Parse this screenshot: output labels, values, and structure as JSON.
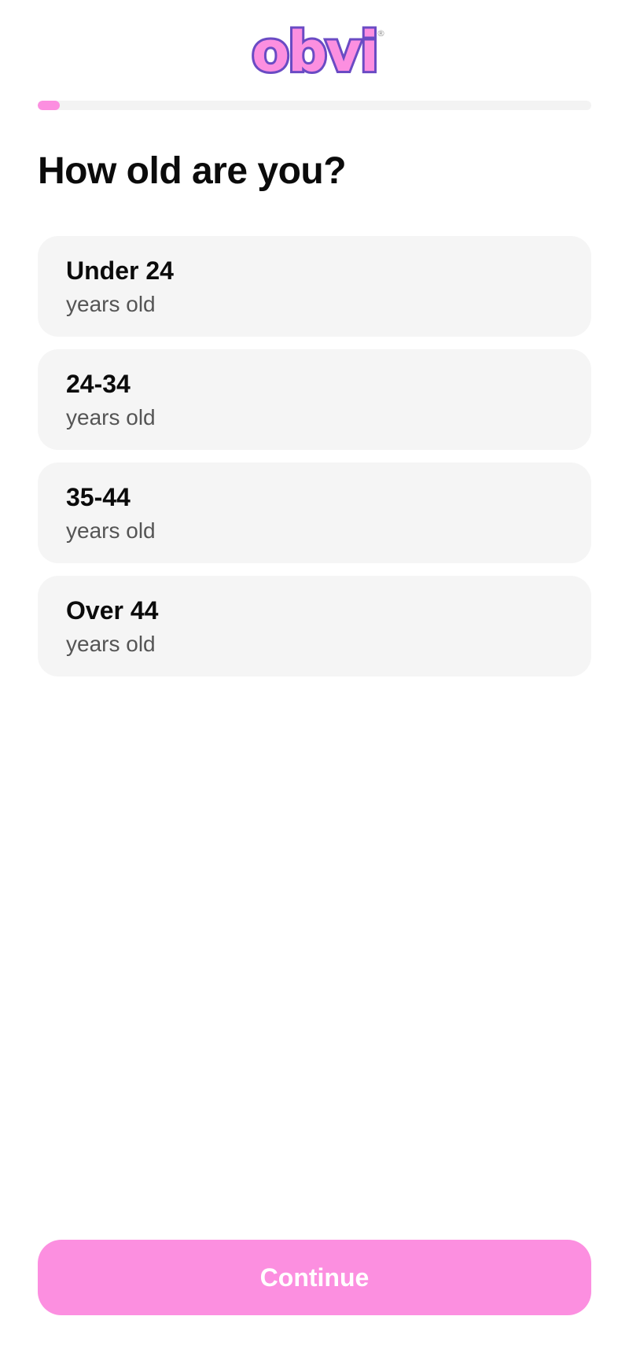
{
  "brand": {
    "logo_text": "obvi",
    "logo_fill_color": "#fc8fe0",
    "logo_outline_color": "#6a4bc4",
    "registered_mark": "®"
  },
  "progress": {
    "fraction": 0.04,
    "fill_color": "#fc8fe0",
    "track_color": "#f3f3f3"
  },
  "question": {
    "title": "How old are you?"
  },
  "options": [
    {
      "label": "Under 24",
      "sublabel": "years old"
    },
    {
      "label": "24-34",
      "sublabel": "years old"
    },
    {
      "label": "35-44",
      "sublabel": "years old"
    },
    {
      "label": "Over 44",
      "sublabel": "years old"
    }
  ],
  "footer": {
    "continue_label": "Continue",
    "button_color": "#fc8fe0"
  }
}
